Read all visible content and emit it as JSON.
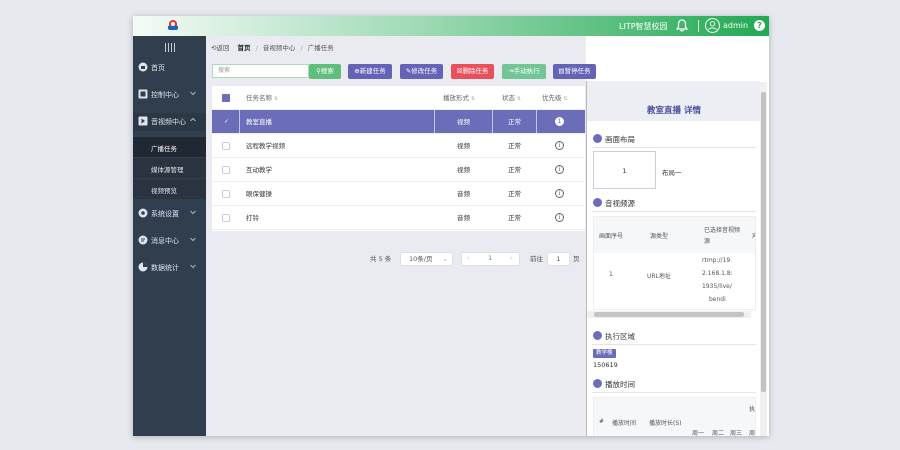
{
  "header": {
    "system_name": "LITP智慧校园",
    "user_name": "admin",
    "help_label": "?"
  },
  "sidebar": {
    "items": [
      {
        "label": "首页",
        "icon": "home-icon"
      },
      {
        "label": "控制中心",
        "icon": "control-icon"
      },
      {
        "label": "音视频中心",
        "icon": "media-icon"
      },
      {
        "label": "系统设置",
        "icon": "settings-icon"
      },
      {
        "label": "消息中心",
        "icon": "message-icon"
      },
      {
        "label": "数据统计",
        "icon": "chart-icon"
      }
    ],
    "subitems": [
      "广播任务",
      "媒体源管理",
      "视频预览"
    ]
  },
  "breadcrumb": {
    "back": "返回",
    "home": "首页",
    "center": "音视频中心",
    "current": "广播任务",
    "separator": "/"
  },
  "toolbar": {
    "search_placeholder": "搜索",
    "search_label": "搜索",
    "new_label": "新建任务",
    "edit_label": "修改任务",
    "delete_label": "删除任务",
    "manual_label": "手动执行",
    "pause_label": "暂停任务"
  },
  "table": {
    "columns": [
      "任务名称",
      "播放形式",
      "状态",
      "优先级"
    ],
    "rows": [
      {
        "name": "教室直播",
        "mode": "视频",
        "status": "正常",
        "priority": "1",
        "selected": true
      },
      {
        "name": "远程教学视频",
        "mode": "视频",
        "status": "正常",
        "priority": "i",
        "selected": false
      },
      {
        "name": "互动教学",
        "mode": "视频",
        "status": "正常",
        "priority": "i",
        "selected": false
      },
      {
        "name": "眼保健操",
        "mode": "音频",
        "status": "正常",
        "priority": "i",
        "selected": false
      },
      {
        "name": "打铃",
        "mode": "音频",
        "status": "正常",
        "priority": "i",
        "selected": false
      }
    ]
  },
  "pagination": {
    "total": "共 5 条",
    "page_size": "10条/页",
    "current_page": "1",
    "goto_label": "前往",
    "goto_value": "1",
    "page_unit": "页"
  },
  "detail": {
    "title": "教室直播 详情",
    "layout_section": "画面布局",
    "layout_count": "1",
    "layout_name": "布局一",
    "av_section": "音视频源",
    "av_headers": [
      "画面序号",
      "源类型",
      "已选择音视频源",
      "声"
    ],
    "av_row": {
      "index": "1",
      "type": "URL地址",
      "source_lines": [
        "rtmp://19",
        "2.168.1.8:",
        "1935/live/",
        "bendi"
      ]
    },
    "area_section": "执行区域",
    "area_tag": "教学楼",
    "area_number": "150619",
    "time_section": "播放时间",
    "time_headers": [
      "#",
      "播放时间",
      "播放时长(S)",
      "执",
      "周一",
      "周二",
      "周三",
      "周"
    ]
  },
  "colors": {
    "brand_green": "#21a952",
    "accent_purple": "#6b6db9",
    "danger_red": "#e8505b",
    "sidebar_bg": "#303e4e"
  }
}
